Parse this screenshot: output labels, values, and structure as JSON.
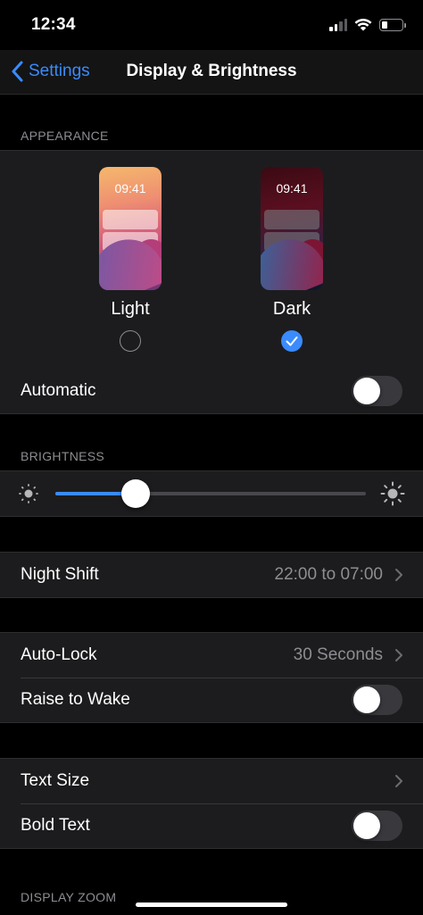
{
  "status_bar": {
    "time": "12:34",
    "battery_level": 0.3
  },
  "nav": {
    "back_label": "Settings",
    "title": "Display & Brightness"
  },
  "appearance": {
    "header": "APPEARANCE",
    "light": {
      "preview_time": "09:41",
      "label": "Light",
      "selected": false
    },
    "dark": {
      "preview_time": "09:41",
      "label": "Dark",
      "selected": true
    },
    "automatic_label": "Automatic",
    "automatic_on": false
  },
  "brightness": {
    "header": "BRIGHTNESS",
    "level": 0.26
  },
  "night_shift": {
    "label": "Night Shift",
    "value": "22:00 to 07:00"
  },
  "auto_lock": {
    "label": "Auto-Lock",
    "value": "30 Seconds"
  },
  "raise_to_wake": {
    "label": "Raise to Wake",
    "on": false
  },
  "text_size": {
    "label": "Text Size"
  },
  "bold_text": {
    "label": "Bold Text",
    "on": false
  },
  "display_zoom": {
    "header": "DISPLAY ZOOM"
  },
  "colors": {
    "accent": "#3a8bfd",
    "group_bg": "#1c1c1e",
    "background": "#000000",
    "secondary_text": "#8d8d92"
  }
}
